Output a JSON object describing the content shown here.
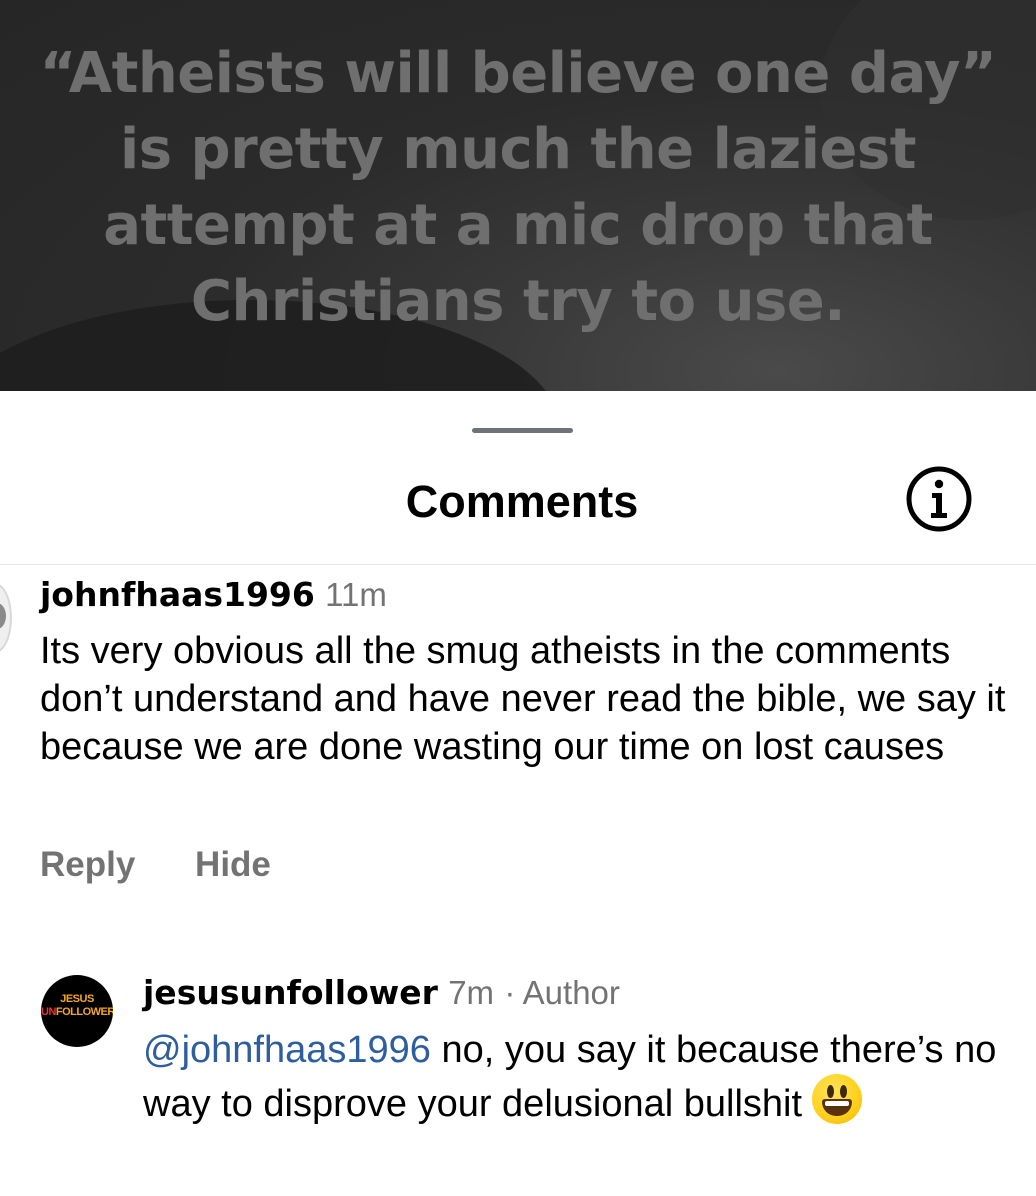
{
  "post": {
    "quote_lines": [
      "“Atheists will believe one day”",
      "is pretty much the laziest",
      "attempt at a mic drop that",
      "Christians try to use."
    ]
  },
  "sheet": {
    "title": "Comments",
    "info_icon": "info-icon"
  },
  "comments": [
    {
      "username": "johnfhaas1996",
      "time": "11m",
      "text": "Its very obvious all the smug atheists in the comments don’t understand and have never read the bible, we say it because we are done wasting our time on lost causes",
      "actions": {
        "reply": "Reply",
        "hide": "Hide"
      }
    },
    {
      "username": "jesusunfollower",
      "time": "7m",
      "author_badge": "· Author",
      "mention": "@johnfhaas1996",
      "text": "no, you say it because there’s no way to disprove your delusional bullshit",
      "emoji": "grinning-face-emoji",
      "avatar_text": {
        "line1": "JESUS",
        "line2_a": "UN",
        "line2_b": "FOLLOWER"
      }
    }
  ]
}
